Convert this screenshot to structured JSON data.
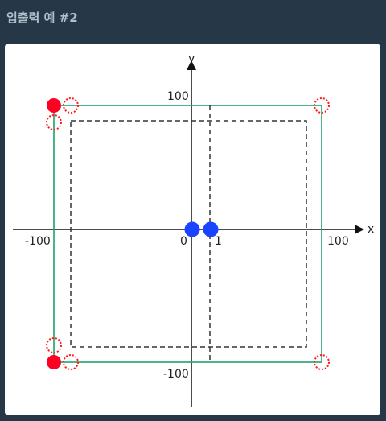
{
  "header": {
    "title": "입출력 예 #2"
  },
  "diagram": {
    "axis_x_name": "x",
    "axis_y_name": "y",
    "tick_x_neg": "-100",
    "tick_x_pos": "100",
    "tick_y_pos": "100",
    "tick_y_neg": "-100",
    "origin_label": "0",
    "one_label": "1"
  },
  "colors": {
    "page_bg": "#263747",
    "card_bg": "#ffffff",
    "square": "#22a06b",
    "dashed": "#333333",
    "red_point": "#ff0022",
    "blue_point": "#1a44ff"
  }
}
